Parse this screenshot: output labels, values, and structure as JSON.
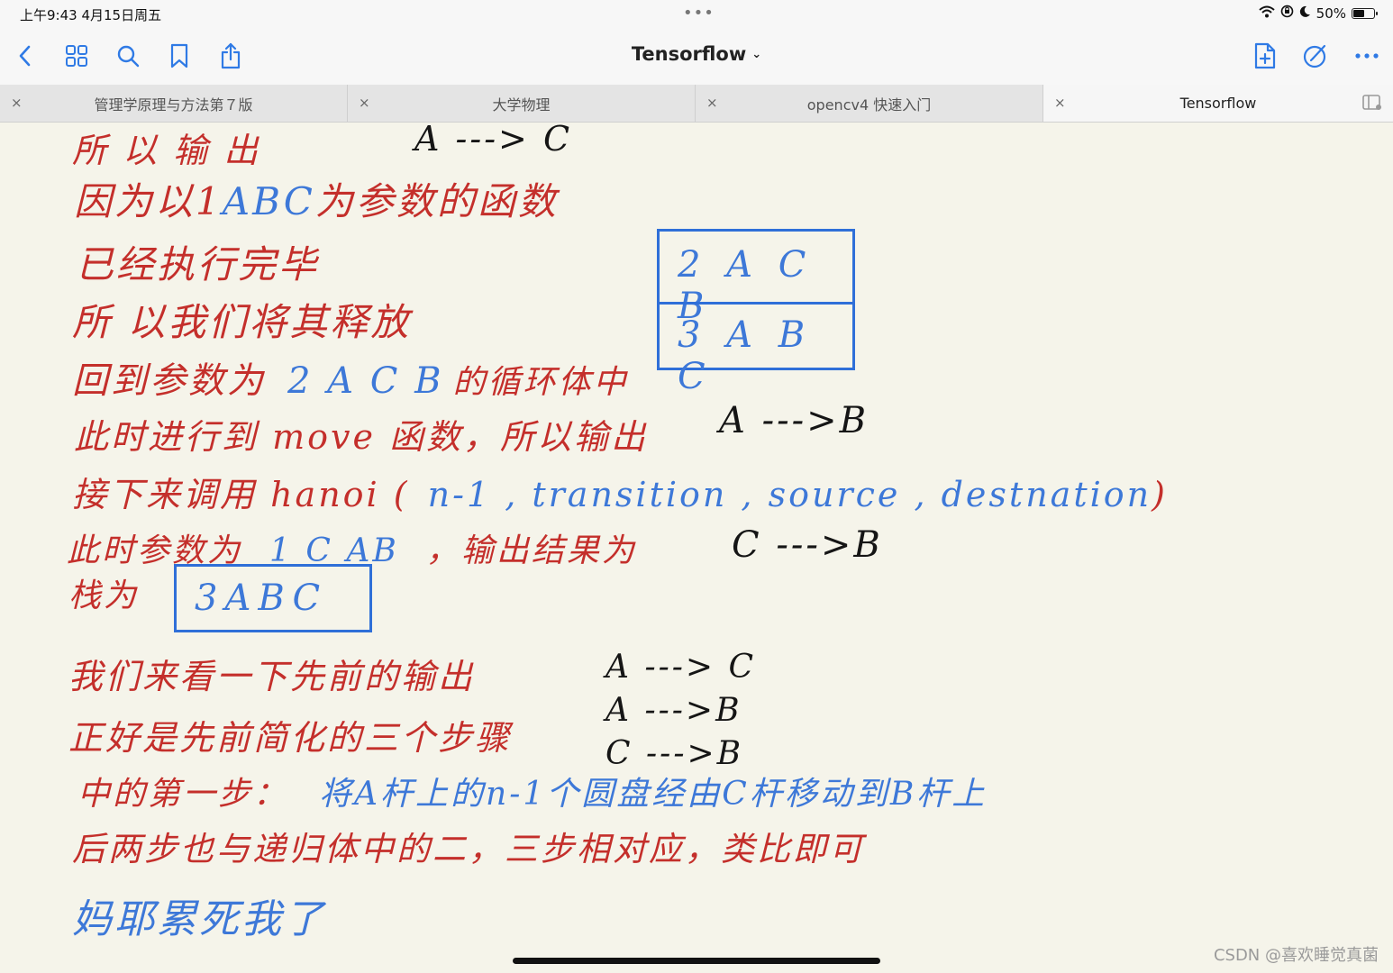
{
  "status_bar": {
    "time": "上午9:43   4月15日周五",
    "dots": "•••",
    "battery_text": "50%",
    "battery_level": 0.5,
    "icons": [
      "wifi-icon",
      "orientation-lock-icon",
      "moon-icon",
      "battery-icon"
    ]
  },
  "toolbar": {
    "title": "Tensorflow",
    "title_chevron": "⌄",
    "left_icons": [
      "back-icon",
      "grid-icon",
      "search-icon",
      "bookmark-icon",
      "share-icon"
    ],
    "right_icons": [
      "new-page-icon",
      "pencil-icon",
      "more-icon"
    ]
  },
  "tabs": [
    {
      "label": "管理学原理与方法第７版",
      "close": "×",
      "active": false
    },
    {
      "label": "大学物理",
      "close": "×",
      "active": false
    },
    {
      "label": "opencv4 快速入门",
      "close": "×",
      "active": false
    },
    {
      "label": "Tensorflow",
      "close": "×",
      "active": true
    }
  ],
  "notes": {
    "line1": "所 以 输 出",
    "line1_result": "A ---> C",
    "line2a": "因为以1",
    "line2b": "ABC",
    "line2c": "为参数的函数",
    "line3": "已经执行完毕",
    "line4": "所 以我们将其释放",
    "line5a": "回到参数为",
    "line5b": "2 A C B",
    "line5c": "的循环体中",
    "line6": "此时进行到  move 函数，所以输出",
    "line6_result": "A --->B",
    "line7a": "接下来调用  hanoi (",
    "line7b": "n-1 , transition , source , destnation",
    "line7c": ")",
    "line8a": "此时参数为",
    "line8b": "1 C AB",
    "line8c": "，输出结果为",
    "line8_result": "C --->B",
    "line9": "栈为",
    "stack_small": "3ABC",
    "stack_top": "2 A C B",
    "stack_bottom": "3 A B C",
    "line10": "我们来看一下先前的输出",
    "outputs": [
      "A ---> C",
      "A --->B",
      "C --->B"
    ],
    "line11": "正好是先前简化的三个步骤",
    "line12a": "中的第一步：",
    "line12b": "将A杆上的n-1个圆盘经由C杆移动到B杆上",
    "line13": "后两步也与递归体中的二，三步相对应，类比即可",
    "line14": "妈耶累死我了"
  },
  "watermark": "CSDN @喜欢睡觉真菌"
}
